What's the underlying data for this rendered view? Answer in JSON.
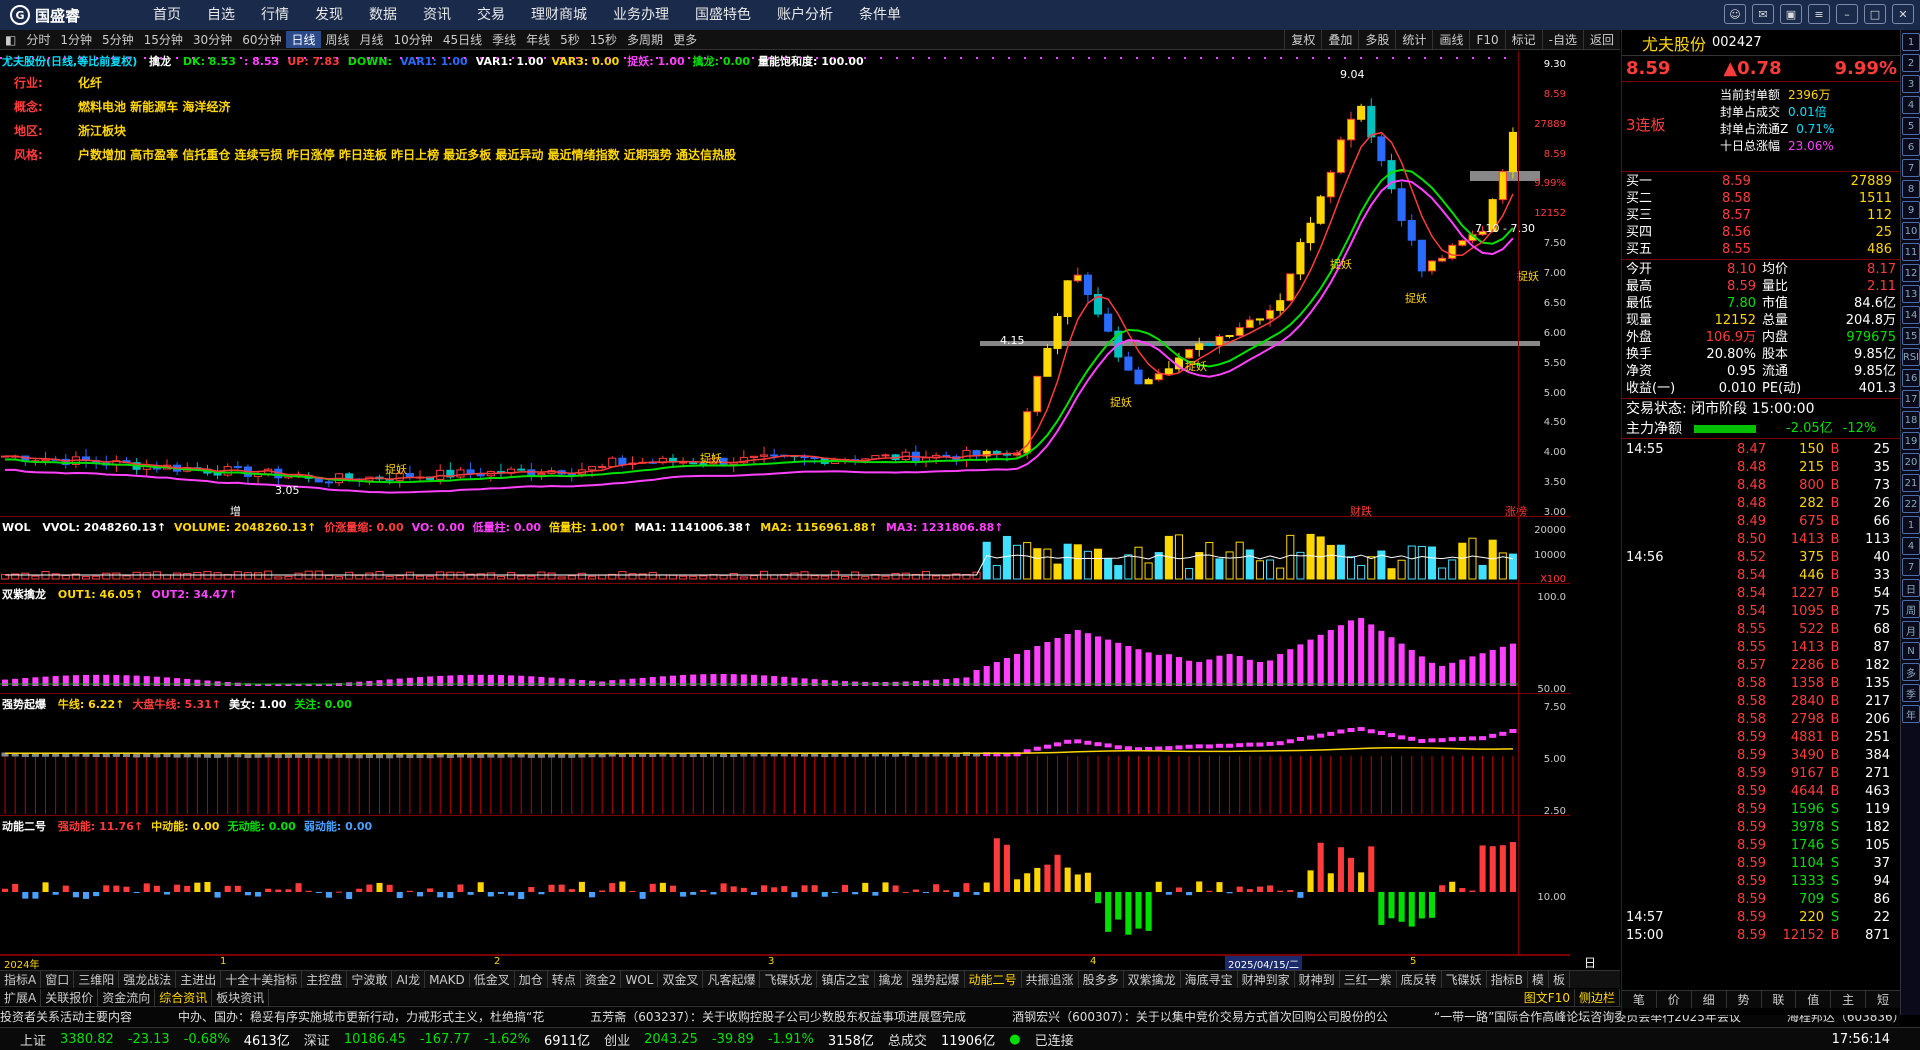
{
  "app": {
    "logo_text": "国盛睿"
  },
  "menu": [
    "首页",
    "自选",
    "行情",
    "发现",
    "数据",
    "资讯",
    "交易",
    "理财商城",
    "业务办理",
    "国盛特色",
    "账户分析",
    "条件单"
  ],
  "periods": [
    "分时",
    "1分钟",
    "5分钟",
    "15分钟",
    "30分钟",
    "60分钟",
    "日线",
    "周线",
    "月线",
    "10分钟",
    "45日线",
    "季线",
    "年线",
    "5秒",
    "15秒",
    "多周期",
    "更多"
  ],
  "active_period": "日线",
  "chart_tools": [
    "复权",
    "叠加",
    "多股",
    "统计",
    "画线",
    "F10",
    "标记",
    "-自选",
    "返回"
  ],
  "main_panel": {
    "title": "尤夫股份(日线,等比前复权)",
    "indicator_name": "擒龙",
    "ind_values": [
      {
        "t": "DK: 8.53",
        "c": "#00e000"
      },
      {
        "t": ": 8.53",
        "c": "#ff40ff"
      },
      {
        "t": "UP: 7.83",
        "c": "#ff3b3b"
      },
      {
        "t": "DOWN:",
        "c": "#00e000"
      },
      {
        "t": "VAR1: 1.00",
        "c": "#2b6aff"
      },
      {
        "t": "VAR1: 1.00",
        "c": "#ffffff"
      },
      {
        "t": "VAR3: 0.00",
        "c": "#ffd700"
      },
      {
        "t": "捉妖: 1.00",
        "c": "#ff40ff"
      },
      {
        "t": "擒龙: 0.00",
        "c": "#00e000"
      },
      {
        "t": "量能饱和度: 100.00",
        "c": "#ffffff"
      }
    ],
    "info_rows": [
      {
        "label": "行业:",
        "value": "化纤"
      },
      {
        "label": "概念:",
        "value": "燃料电池 新能源车 海洋经济"
      },
      {
        "label": "地区:",
        "value": "浙江板块"
      },
      {
        "label": "风格:",
        "value": "户数增加 高市盈率 信托重仓 连续亏损 昨日涨停 昨日连板 昨日上榜 最近多板 最近异动 最近情绪指数 近期强势 通达信热股"
      }
    ],
    "y_ticks": [
      "9.30",
      "8.59",
      "27889",
      "8.59",
      "9.99%",
      "12152",
      "7.50",
      "7.00",
      "6.50",
      "6.00",
      "5.50",
      "5.00",
      "4.50",
      "4.00",
      "3.50",
      "3.00"
    ],
    "annotations": [
      "9.04",
      "7.10 - 7.30",
      "4.15",
      "3.05",
      "捉妖",
      "捉妖",
      "捉妖",
      "捉妖",
      "捉妖",
      "捉妖",
      "捉妖",
      "财跌",
      "涨榜",
      "增"
    ]
  },
  "vol_panel": {
    "title": "WOL",
    "values": [
      {
        "t": "VVOL: 2048260.13↑",
        "c": "#ffffff"
      },
      {
        "t": "VOLUME: 2048260.13↑",
        "c": "#ffd700"
      },
      {
        "t": "价涨量缩: 0.00",
        "c": "#ff3b3b"
      },
      {
        "t": "VO: 0.00",
        "c": "#ff40ff"
      },
      {
        "t": "低量柱: 0.00",
        "c": "#ff40ff"
      },
      {
        "t": "倍量柱: 1.00↑",
        "c": "#ffd700"
      },
      {
        "t": "MA1: 1141006.38↑",
        "c": "#ffffff"
      },
      {
        "t": "MA2: 1156961.88↑",
        "c": "#ffd700"
      },
      {
        "t": "MA3: 1231806.88↑",
        "c": "#ff40ff"
      }
    ],
    "y_ticks": [
      "20000",
      "10000",
      "X100"
    ]
  },
  "sz_panel": {
    "title": "双紫擒龙",
    "values": [
      {
        "t": "OUT1: 46.05↑",
        "c": "#ffd700"
      },
      {
        "t": "OUT2: 34.47↑",
        "c": "#ff40ff"
      }
    ],
    "y_ticks": [
      "100.0",
      "50.00"
    ]
  },
  "qs_panel": {
    "title": "强势起爆",
    "values": [
      {
        "t": "牛线: 6.22↑",
        "c": "#ffd700"
      },
      {
        "t": "大盘牛线: 5.31↑",
        "c": "#ff3b3b"
      },
      {
        "t": "美女: 1.00",
        "c": "#ffffff"
      },
      {
        "t": "关注: 0.00",
        "c": "#00e000"
      }
    ],
    "y_ticks": [
      "7.50",
      "5.00",
      "2.50"
    ]
  },
  "dn_panel": {
    "title": "动能二号",
    "values": [
      {
        "t": "强动能: 11.76↑",
        "c": "#ff3b3b"
      },
      {
        "t": "中动能: 0.00",
        "c": "#ffd700"
      },
      {
        "t": "无动能: 0.00",
        "c": "#00e000"
      },
      {
        "t": "弱动能: 0.00",
        "c": "#4aa0ff"
      }
    ],
    "y_ticks": [
      "10.00"
    ]
  },
  "date_axis": {
    "labels": [
      "2024年",
      "1",
      "2",
      "3",
      "4",
      "5"
    ],
    "cursor_date": "2025/04/15/二",
    "right_label": "日线"
  },
  "quote": {
    "name": "尤夫股份",
    "code": "002427",
    "price": "8.59",
    "change": "▲0.78",
    "pct": "9.99%",
    "limit_label": "3连板",
    "limit_rows": [
      {
        "l": "当前封单额",
        "v": "2396万",
        "c": "#ffd700"
      },
      {
        "l": "封单占成交",
        "v": "0.01倍",
        "c": "#00e0ff"
      },
      {
        "l": "封单占流通Z",
        "v": "0.71%",
        "c": "#00e0ff"
      },
      {
        "l": "十日总涨幅",
        "v": "23.06%",
        "c": "#ff40ff"
      }
    ],
    "bids": [
      {
        "l": "买一",
        "p": "8.59",
        "v": "27889"
      },
      {
        "l": "买二",
        "p": "8.58",
        "v": "1511"
      },
      {
        "l": "买三",
        "p": "8.57",
        "v": "112"
      },
      {
        "l": "买四",
        "p": "8.56",
        "v": "25"
      },
      {
        "l": "买五",
        "p": "8.55",
        "v": "486"
      }
    ],
    "stats": [
      {
        "l1": "今开",
        "v1": "8.10",
        "c1": "#ff3b3b",
        "l2": "均价",
        "v2": "8.17",
        "c2": "#ff3b3b"
      },
      {
        "l1": "最高",
        "v1": "8.59",
        "c1": "#ff3b3b",
        "l2": "量比",
        "v2": "2.11",
        "c2": "#ff3b3b"
      },
      {
        "l1": "最低",
        "v1": "7.80",
        "c1": "#00e000",
        "l2": "市值",
        "v2": "84.6亿",
        "c2": "#ffffff"
      },
      {
        "l1": "现量",
        "v1": "12152",
        "c1": "#ffd700",
        "l2": "总量",
        "v2": "204.8万",
        "c2": "#ffffff"
      },
      {
        "l1": "外盘",
        "v1": "106.9万",
        "c1": "#ff3b3b",
        "l2": "内盘",
        "v2": "979675",
        "c2": "#00e000"
      },
      {
        "l1": "换手",
        "v1": "20.80%",
        "c1": "#ffffff",
        "l2": "股本",
        "v2": "9.85亿",
        "c2": "#ffffff"
      },
      {
        "l1": "净资",
        "v1": "0.95",
        "c1": "#ffffff",
        "l2": "流通",
        "v2": "9.85亿",
        "c2": "#ffffff"
      },
      {
        "l1": "收益(一)",
        "v1": "0.010",
        "c1": "#ffffff",
        "l2": "PE(动)",
        "v2": "401.3",
        "c2": "#ffffff"
      }
    ],
    "trade_status": "交易状态: 闭市阶段 15:00:00",
    "main_net_label": "主力净额",
    "main_net": "-2.05亿",
    "main_net_pct": "-12%",
    "ticks": [
      {
        "time": "14:55",
        "p": "8.47",
        "v": "150",
        "s": "B",
        "n": "25",
        "pc": "r",
        "vc": "y"
      },
      {
        "time": "",
        "p": "8.48",
        "v": "215",
        "s": "B",
        "n": "35",
        "pc": "r",
        "vc": "y"
      },
      {
        "time": "",
        "p": "8.48",
        "v": "800",
        "s": "B",
        "n": "73",
        "pc": "r",
        "vc": "r"
      },
      {
        "time": "",
        "p": "8.48",
        "v": "282",
        "s": "B",
        "n": "26",
        "pc": "r",
        "vc": "y"
      },
      {
        "time": "",
        "p": "8.49",
        "v": "675",
        "s": "B",
        "n": "66",
        "pc": "r",
        "vc": "r"
      },
      {
        "time": "",
        "p": "8.50",
        "v": "1413",
        "s": "B",
        "n": "113",
        "pc": "r",
        "vc": "r"
      },
      {
        "time": "14:56",
        "p": "8.52",
        "v": "375",
        "s": "B",
        "n": "40",
        "pc": "r",
        "vc": "y"
      },
      {
        "time": "",
        "p": "8.54",
        "v": "446",
        "s": "B",
        "n": "33",
        "pc": "r",
        "vc": "y"
      },
      {
        "time": "",
        "p": "8.54",
        "v": "1227",
        "s": "B",
        "n": "54",
        "pc": "r",
        "vc": "r"
      },
      {
        "time": "",
        "p": "8.54",
        "v": "1095",
        "s": "B",
        "n": "75",
        "pc": "r",
        "vc": "r"
      },
      {
        "time": "",
        "p": "8.55",
        "v": "522",
        "s": "B",
        "n": "68",
        "pc": "r",
        "vc": "r"
      },
      {
        "time": "",
        "p": "8.55",
        "v": "1413",
        "s": "B",
        "n": "87",
        "pc": "r",
        "vc": "r"
      },
      {
        "time": "",
        "p": "8.57",
        "v": "2286",
        "s": "B",
        "n": "182",
        "pc": "r",
        "vc": "r"
      },
      {
        "time": "",
        "p": "8.58",
        "v": "1358",
        "s": "B",
        "n": "135",
        "pc": "r",
        "vc": "r"
      },
      {
        "time": "",
        "p": "8.58",
        "v": "2840",
        "s": "B",
        "n": "217",
        "pc": "r",
        "vc": "r"
      },
      {
        "time": "",
        "p": "8.58",
        "v": "2798",
        "s": "B",
        "n": "206",
        "pc": "r",
        "vc": "r"
      },
      {
        "time": "",
        "p": "8.59",
        "v": "4881",
        "s": "B",
        "n": "251",
        "pc": "r",
        "vc": "r"
      },
      {
        "time": "",
        "p": "8.59",
        "v": "3490",
        "s": "B",
        "n": "384",
        "pc": "r",
        "vc": "r"
      },
      {
        "time": "",
        "p": "8.59",
        "v": "9167",
        "s": "B",
        "n": "271",
        "pc": "r",
        "vc": "r"
      },
      {
        "time": "",
        "p": "8.59",
        "v": "4644",
        "s": "B",
        "n": "463",
        "pc": "r",
        "vc": "r"
      },
      {
        "time": "",
        "p": "8.59",
        "v": "1596",
        "s": "S",
        "n": "119",
        "pc": "r",
        "vc": "g"
      },
      {
        "time": "",
        "p": "8.59",
        "v": "3978",
        "s": "S",
        "n": "182",
        "pc": "r",
        "vc": "g"
      },
      {
        "time": "",
        "p": "8.59",
        "v": "1746",
        "s": "S",
        "n": "105",
        "pc": "r",
        "vc": "g"
      },
      {
        "time": "",
        "p": "8.59",
        "v": "1104",
        "s": "S",
        "n": "37",
        "pc": "r",
        "vc": "g"
      },
      {
        "time": "",
        "p": "8.59",
        "v": "1333",
        "s": "S",
        "n": "94",
        "pc": "r",
        "vc": "g"
      },
      {
        "time": "",
        "p": "8.59",
        "v": "709",
        "s": "S",
        "n": "86",
        "pc": "r",
        "vc": "g"
      },
      {
        "time": "14:57",
        "p": "8.59",
        "v": "220",
        "s": "S",
        "n": "22",
        "pc": "r",
        "vc": "y"
      },
      {
        "time": "15:00",
        "p": "8.59",
        "v": "12152",
        "s": "B",
        "n": "871",
        "pc": "r",
        "vc": "r"
      }
    ],
    "bottom_tabs": [
      "笔",
      "价",
      "细",
      "势",
      "联",
      "值",
      "主",
      "短"
    ]
  },
  "side_icons": [
    "1",
    "2",
    "3",
    "4",
    "5",
    "6",
    "7",
    "8",
    "9",
    "10",
    "11",
    "12",
    "13",
    "14",
    "15",
    "RSI",
    "16",
    "17",
    "18",
    "19",
    "20",
    "21",
    "22",
    "1",
    "4",
    "7",
    "日",
    "周",
    "月",
    "N",
    "多",
    "季",
    "年"
  ],
  "func_tabs": [
    "指标A",
    "窗口",
    "三维阳",
    "强龙战法",
    "主进出",
    "十全十美指标",
    "主控盘",
    "宁波敢",
    "AI龙",
    "MAKD",
    "低金叉",
    "加仓",
    "转点",
    "资金2",
    "WOL",
    "双金叉",
    "凡客起爆",
    "飞碟妖龙",
    "镇店之宝",
    "擒龙",
    "强势起爆",
    "动能二号",
    "共振追涨",
    "股多多",
    "双紫擒龙",
    "海底寻宝",
    "财神到家",
    "财神到",
    "三红一紫",
    "底反转",
    "飞碟妖",
    "指标B",
    "模",
    "板"
  ],
  "active_func_tab": "动能二号",
  "sub_tabs": [
    "扩展A",
    "关联报价",
    "资金流向",
    "综合资讯",
    "板块资讯"
  ],
  "sub_tabs_right": [
    "图文F10",
    "侧边栏"
  ],
  "news": [
    "投资者关系活动主要内容",
    "中办、国办：稳妥有序实施城市更新行动，力戒形式主义，杜绝搞“花",
    "五芳斋（603237）：关于收购控股子公司少数股东权益事项进展暨完成",
    "酒钢宏兴（600307）：关于以集中竞价交易方式首次回购公司股份的公",
    "“一带一路”国际合作高峰论坛咨询委员会举行2025年会议",
    "海程邦达（603836）：股票"
  ],
  "status": {
    "sh_label": "上证",
    "sh_val": "3380.82",
    "sh_chg": "-23.13",
    "sh_pct": "-0.68%",
    "sh_amt": "4613亿",
    "sz_label": "深证",
    "sz_val": "10186.45",
    "sz_chg": "-167.77",
    "sz_pct": "-1.62%",
    "sz_amt": "6911亿",
    "cy_label": "创业",
    "cy_val": "2043.25",
    "cy_chg": "-39.89",
    "cy_pct": "-1.91%",
    "cy_amt": "3158亿",
    "total_label": "总成交",
    "total_amt": "11906亿",
    "conn": "已连接",
    "clock": "17:56:14"
  }
}
